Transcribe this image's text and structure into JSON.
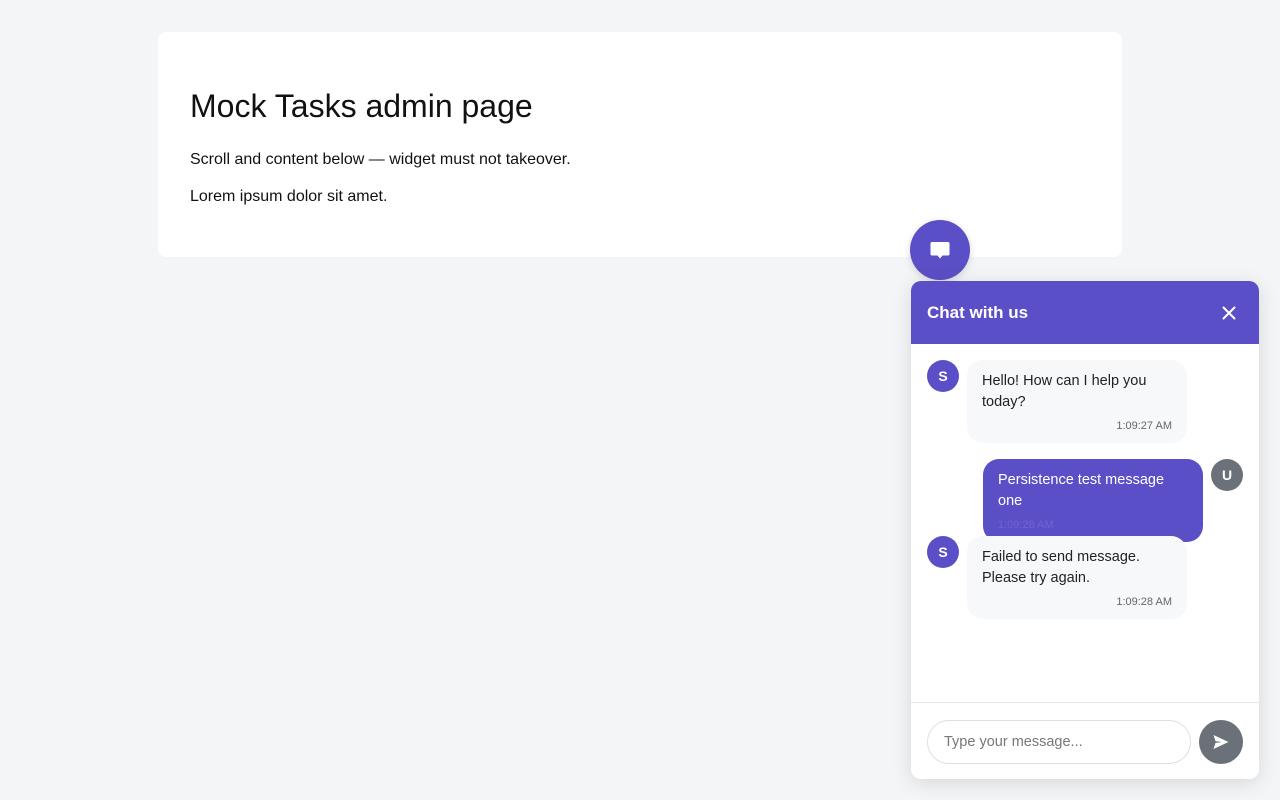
{
  "page": {
    "title": "Mock Tasks admin page",
    "paragraphs": [
      "Scroll and content below — widget must not takeover.",
      "Lorem ipsum dolor sit amet."
    ]
  },
  "launcher": {
    "icon": "chat-bubble-icon"
  },
  "chat": {
    "title": "Chat with us",
    "close_icon": "close-icon",
    "messages": [
      {
        "sender": "system",
        "avatar": "S",
        "text": "Hello! How can I help you today?",
        "time": "1:09:27 AM"
      },
      {
        "sender": "user",
        "avatar": "U",
        "text": "Persistence test message one",
        "time": "1:09:28 AM"
      },
      {
        "sender": "system",
        "avatar": "S",
        "text": "Failed to send message. Please try again.",
        "time": "1:09:28 AM"
      }
    ],
    "input": {
      "placeholder": "Type your message...",
      "value": ""
    },
    "send_icon": "send-icon"
  },
  "colors": {
    "accent": "#5b4fc7",
    "user_avatar": "#6b7178",
    "send_button": "#6b7178",
    "page_background": "#f4f5f7",
    "system_bubble": "#f7f8fa"
  }
}
